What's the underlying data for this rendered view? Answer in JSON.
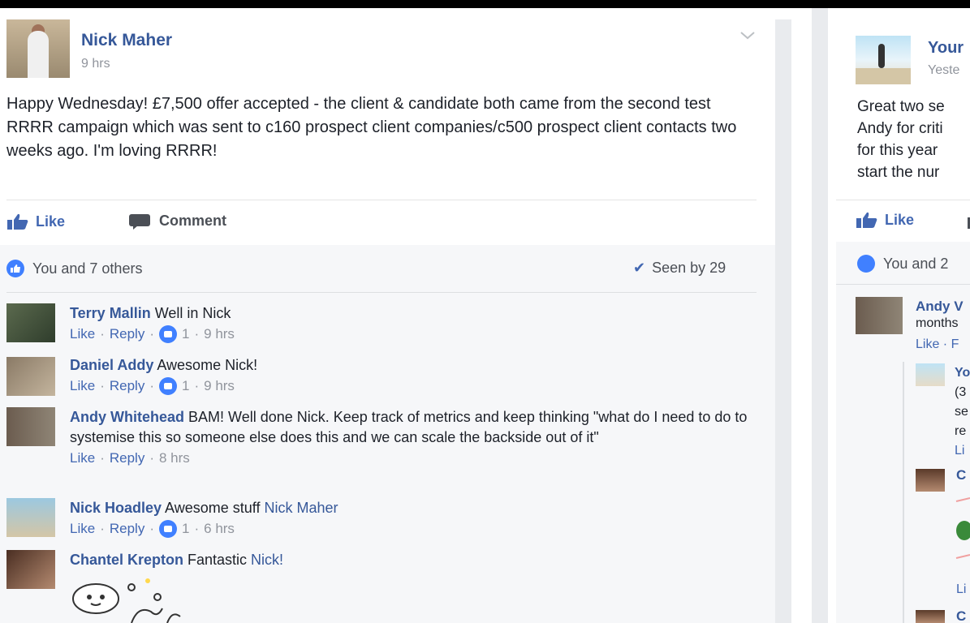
{
  "left_post": {
    "author": "Nick Maher",
    "time": "9 hrs",
    "text": "Happy Wednesday! £7,500 offer accepted - the client & candidate both came from the second test RRRR campaign which was sent to c160 prospect client companies/c500 prospect client contacts two weeks ago. I'm loving RRRR!",
    "actions": {
      "like": "Like",
      "comment": "Comment"
    },
    "reactions": "You and 7 others",
    "seen": "Seen by 29",
    "comments": [
      {
        "name": "Terry Mallin",
        "text": " Well in Nick",
        "like": "Like",
        "reply": "Reply",
        "likes": "1",
        "time": "9 hrs"
      },
      {
        "name": "Daniel Addy",
        "text": " Awesome Nick!",
        "like": "Like",
        "reply": "Reply",
        "likes": "1",
        "time": "9 hrs"
      },
      {
        "name": "Andy Whitehead",
        "text": " BAM! Well done Nick. Keep track of metrics and keep thinking \"what do I need to do to systemise this so someone else does this and we can scale the backside out of it\"",
        "like": "Like",
        "reply": "Reply",
        "time": "8 hrs"
      },
      {
        "name": "Nick Hoadley",
        "text": " Awesome stuff ",
        "mention": "Nick Maher",
        "like": "Like",
        "reply": "Reply",
        "likes": "1",
        "time": "6 hrs"
      },
      {
        "name": "Chantel Krepton",
        "text": " Fantastic ",
        "mention": "Nick!"
      }
    ]
  },
  "right_post": {
    "author": "Your",
    "time": "Yeste",
    "text_lines": [
      "Great two se",
      "Andy for criti",
      "for this year",
      "start the nur"
    ],
    "like": "Like",
    "reactions": "You and 2",
    "comment": {
      "name": "Andy V",
      "text": "months",
      "meta": "Like · F"
    },
    "reply": {
      "lines": [
        "Yo",
        "(3",
        "se",
        "re",
        "Li"
      ]
    },
    "reply2_name": "C",
    "reply2_meta": "Li",
    "reply3_name": "C"
  }
}
